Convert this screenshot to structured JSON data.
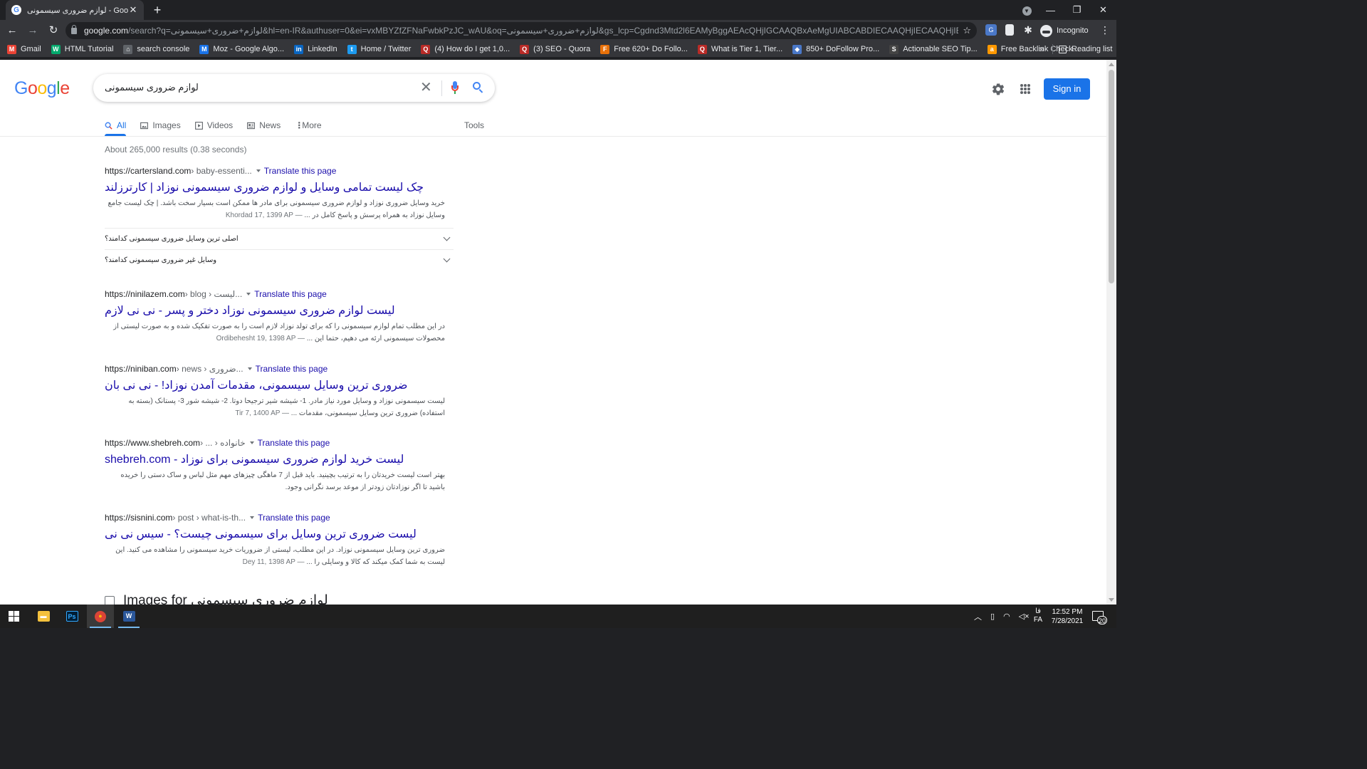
{
  "browser": {
    "tab_title": "لوازم ضروری سیسمونی - Google Search",
    "url_host": "google.com",
    "url_rest": "/search?q=لوازم+ضروری+سیسمونی&hl=en-IR&authuser=0&ei=vxMBYZfZFNaFwbkPzJC_wAU&oq=لوازم+ضروری+سیسمونی&gs_lcp=Cgdnd3Mtd2l6EAMyBggAEAcQHjIGCAAQBxAeMgUIABCABDIECAAQHjIECAAQHjIECAA...",
    "profile_label": "Incognito",
    "bookmarks": [
      {
        "label": "Gmail",
        "icon": "gmail-icon",
        "color": "#ea4335",
        "glyph": "M"
      },
      {
        "label": "HTML Tutorial",
        "icon": "w3schools-icon",
        "color": "#04aa6d",
        "glyph": "W"
      },
      {
        "label": "search console",
        "icon": "search-console-icon",
        "color": "#5f6368",
        "glyph": "⌂"
      },
      {
        "label": "Moz - Google Algo...",
        "icon": "moz-icon",
        "color": "#1a73e8",
        "glyph": "M"
      },
      {
        "label": "LinkedIn",
        "icon": "linkedin-icon",
        "color": "#0a66c2",
        "glyph": "in"
      },
      {
        "label": "Home / Twitter",
        "icon": "twitter-icon",
        "color": "#1d9bf0",
        "glyph": "t"
      },
      {
        "label": "(4) How do I get 1,0...",
        "icon": "quora-icon",
        "color": "#b92b27",
        "glyph": "Q"
      },
      {
        "label": "(3) SEO - Quora",
        "icon": "quora-icon",
        "color": "#b92b27",
        "glyph": "Q"
      },
      {
        "label": "Free 620+ Do Follo...",
        "icon": "site-icon",
        "color": "#e8710a",
        "glyph": "F"
      },
      {
        "label": "What is Tier 1, Tier...",
        "icon": "quora-icon",
        "color": "#b92b27",
        "glyph": "Q"
      },
      {
        "label": "850+ DoFollow Pro...",
        "icon": "site-icon",
        "color": "#4a78c8",
        "glyph": "◆"
      },
      {
        "label": "Actionable SEO Tip...",
        "icon": "site-icon",
        "color": "#444444",
        "glyph": "S"
      },
      {
        "label": "Free Backlink Check...",
        "icon": "amazon-icon",
        "color": "#ff9900",
        "glyph": "a"
      }
    ],
    "reading_list_label": "Reading list"
  },
  "google": {
    "logo_letters": [
      "G",
      "o",
      "o",
      "g",
      "l",
      "e"
    ],
    "query": "لوازم ضروری سیسمونی",
    "signin_label": "Sign in",
    "tabs": [
      {
        "label": "All",
        "icon": "search-icon",
        "active": true
      },
      {
        "label": "Images",
        "icon": "image-icon",
        "active": false
      },
      {
        "label": "Videos",
        "icon": "video-icon",
        "active": false
      },
      {
        "label": "News",
        "icon": "news-icon",
        "active": false
      },
      {
        "label": "More",
        "icon": "more-icon",
        "active": false
      }
    ],
    "tools_label": "Tools",
    "result_stats": "About 265,000 results (0.38 seconds)",
    "translate_label": "Translate this page",
    "results": [
      {
        "domain": "https://cartersland.com",
        "path": " › baby-essenti...",
        "title": "چک لیست تمامی وسایل و لوازم ضروری سیسمونی نوزاد | کارترزلند",
        "date": "Khordad 17, 1399 AP —",
        "snippet": "خرید وسایل ضروری نوزاد و لوازم ضروری سیسمونی برای مادر ها ممکن است بسیار سخت باشد. | چک لیست جامع وسایل نوزاد به همراه پرسش و پاسخ کامل در ..."
      },
      {
        "domain": "https://ninilazem.com",
        "path": " › blog › لیست...",
        "title": "لیست لوازم ضروری سیسمونی نوزاد دختر و پسر - نی نی لازم",
        "date": "Ordibehesht 19, 1398 AP —",
        "snippet": "در این مطلب تمام لوازم سیسمونی را که برای تولد نوزاد لازم است را به صورت تفکیک شده و به صورت لیستی از محصولات سیسمونی ارئه می دهیم، حتما این ..."
      },
      {
        "domain": "https://niniban.com",
        "path": " › news › ضروری...",
        "title": "ضروری ترین وسایل سیسمونی، مقدمات آمدن نوزاد! - نی نی بان",
        "date": "Tir 7, 1400 AP —",
        "snippet": "لیست سیسمونی نوزاد و وسایل مورد نیاز مادر. 1- شیشه شیر ترجیحا دوتا. 2- شیشه شور 3- پستانک (بسته به استفاده) ضروری ترین وسایل سیسمونی، مقدمات ..."
      },
      {
        "domain": "https://www.shebreh.com",
        "path": " › ... › خانواده",
        "title": "لیست خرید لوازم ضروری سیسمونی برای نوزاد - shebreh.com",
        "date": "",
        "snippet": "بهتر است لیست خریدتان را به ترتیب بچینید. باید قبل از 7 ماهگی چیزهای مهم مثل لباس و ساک دستی را خریده باشید تا اگر نوزادتان زودتر از موعد برسد نگرانی وجود."
      },
      {
        "domain": "https://sisnini.com",
        "path": " › post › what-is-th...",
        "title": "لیست ضروری ترین وسایل برای سیسمونی چیست؟ - سیس نی نی",
        "date": "Dey 11, 1398 AP —",
        "snippet": "ضروری ترین وسایل سیسمونی نوزاد. در این مطلب، لیستی از ضروریات خرید سیسمونی را مشاهده می کنید. این لیست به شما کمک میکند که کالا و وسایلی را ..."
      }
    ],
    "related_questions": [
      "اصلی ترین وسایل ضروری سیسمونی کدامند؟",
      "وسایل غیر ضروری سیسمونی کدامند؟"
    ],
    "images_for_label": "Images for لوازم ضروری سیسمونی"
  },
  "taskbar": {
    "apps": [
      {
        "name": "file-explorer-icon",
        "color": "#f4c13d",
        "glyph": "▬"
      },
      {
        "name": "photoshop-icon",
        "color": "#001e36",
        "glyph": "Ps"
      },
      {
        "name": "chrome-icon",
        "color": "#db4437",
        "glyph": "●"
      },
      {
        "name": "word-icon",
        "color": "#2b579a",
        "glyph": "W"
      }
    ],
    "lang_fa": "فا",
    "lang_code": "FA",
    "time": "12:52 PM",
    "date": "7/28/2021",
    "notification_count": "20"
  }
}
